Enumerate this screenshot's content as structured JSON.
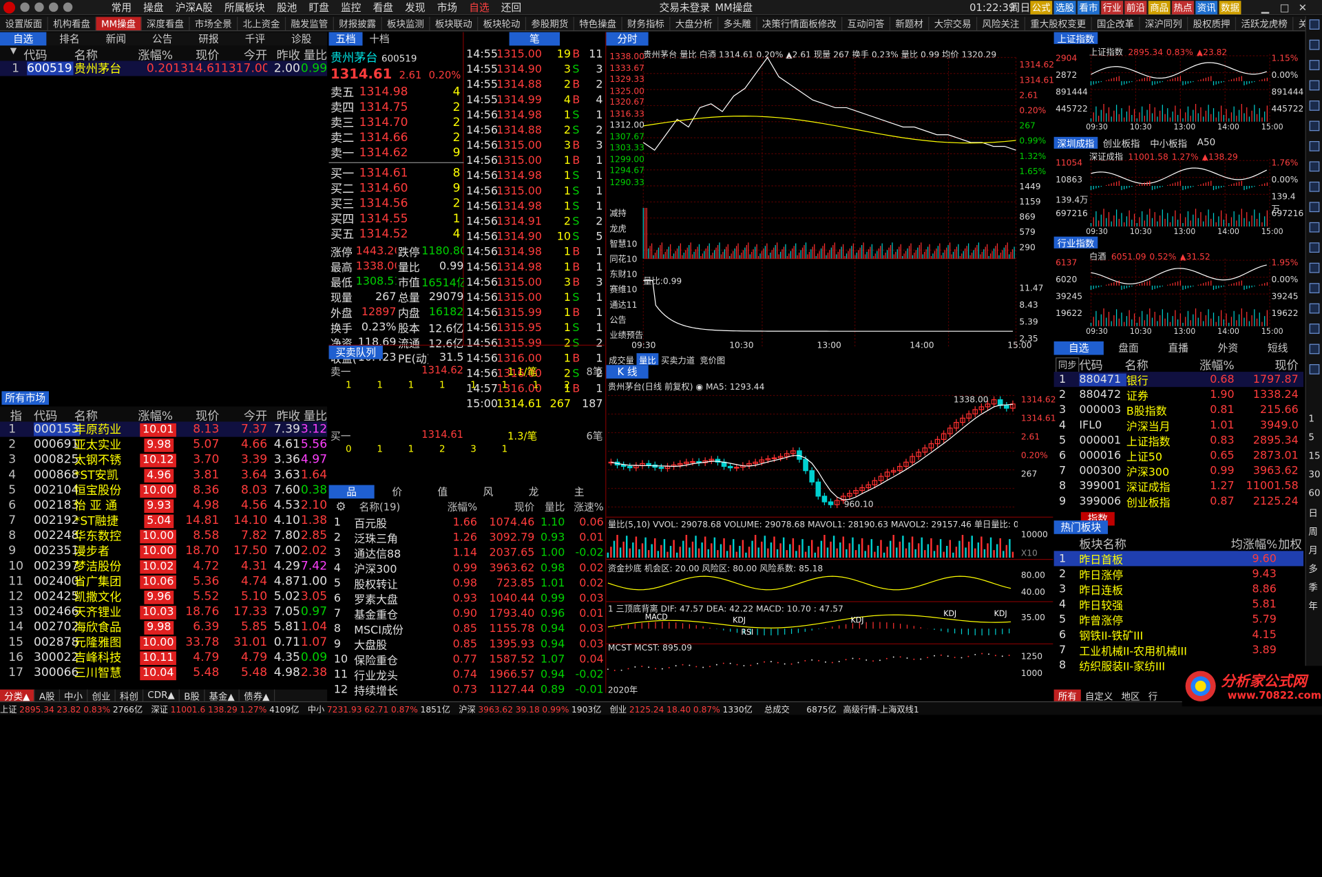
{
  "titlebar": {
    "menu": [
      "常用",
      "操盘",
      "沪深A股",
      "所属板块",
      "股池",
      "盯盘",
      "监控",
      "看盘",
      "发现",
      "市场",
      "自选",
      "还回"
    ],
    "center_tabs": [
      "交易未登录",
      "MM操盘"
    ],
    "clock": "01:22:39",
    "weekday": "周日",
    "right_buttons": [
      "公式",
      "选股",
      "看市",
      "行业",
      "前沿",
      "商品",
      "热点",
      "资讯",
      "数据"
    ]
  },
  "toolbar": {
    "items": [
      "设置版面",
      "机构看盘",
      "MM操盘",
      "深度看盘",
      "市场全景",
      "北上资金",
      "融发监管",
      "财报披露",
      "板块监测",
      "板块联动",
      "板块轮动",
      "参股期货",
      "特色操盘",
      "财务指标",
      "大盘分析",
      "多头雕",
      "决策行情面板修改",
      "互动问答",
      "新题材",
      "大宗交易",
      "风险关注",
      "重大股权变更",
      "国企改革",
      "深沪同列",
      "股权质押",
      "活跃龙虎榜",
      "关注"
    ]
  },
  "left_tabs": [
    "自选",
    "排名",
    "新闻",
    "公告",
    "研报",
    "千评",
    "诊股"
  ],
  "watch_headers": [
    "代码",
    "名称",
    "涨幅%",
    "现价",
    "今开",
    "昨收",
    "量比"
  ],
  "watch": [
    {
      "n": "1",
      "code": "600519",
      "name": "贵州茅台",
      "chg": "0.20",
      "price": "1314.61",
      "open": "1317.00",
      "prev": "2.00",
      "vr": "0.99"
    }
  ],
  "market_title": "所有市场",
  "market_headers": [
    "指",
    "代码",
    "名称",
    "涨幅%",
    "现价",
    "今开",
    "昨收",
    "量比"
  ],
  "market": [
    {
      "n": "1",
      "code": "000153",
      "name": "丰原药业",
      "chg": "10.01",
      "price": "8.13",
      "open": "7.37",
      "prev": "7.39",
      "vr": "3.12",
      "vc": "mag"
    },
    {
      "n": "2",
      "code": "000691",
      "name": "亚太实业",
      "chg": "9.98",
      "price": "5.07",
      "open": "4.66",
      "prev": "4.61",
      "vr": "5.56",
      "vc": "mag"
    },
    {
      "n": "3",
      "code": "000825",
      "name": "太钢不锈",
      "chg": "10.12",
      "price": "3.70",
      "open": "3.39",
      "prev": "3.36",
      "vr": "4.97",
      "vc": "mag"
    },
    {
      "n": "4",
      "code": "000868",
      "name": "*ST安凯",
      "chg": "4.96",
      "price": "3.81",
      "open": "3.64",
      "prev": "3.63",
      "vr": "1.64",
      "vc": "red"
    },
    {
      "n": "5",
      "code": "002104",
      "name": "恒宝股份",
      "chg": "10.00",
      "price": "8.36",
      "open": "8.03",
      "prev": "7.60",
      "vr": "0.38",
      "vc": "grn"
    },
    {
      "n": "6",
      "code": "002183",
      "name": "怡 亚 通",
      "chg": "9.93",
      "price": "4.98",
      "open": "4.56",
      "prev": "4.53",
      "vr": "2.10",
      "vc": "red"
    },
    {
      "n": "7",
      "code": "002192",
      "name": "*ST融捷",
      "chg": "5.04",
      "price": "14.81",
      "open": "14.10",
      "prev": "4.10",
      "vr": "1.38",
      "vc": "red"
    },
    {
      "n": "8",
      "code": "002248",
      "name": "华东数控",
      "chg": "10.00",
      "price": "8.58",
      "open": "7.82",
      "prev": "7.80",
      "vr": "2.85",
      "vc": "red"
    },
    {
      "n": "9",
      "code": "002351",
      "name": "漫步者",
      "chg": "10.00",
      "price": "18.70",
      "open": "17.50",
      "prev": "7.00",
      "vr": "2.02",
      "vc": "red"
    },
    {
      "n": "10",
      "code": "002397",
      "name": "梦洁股份",
      "chg": "10.02",
      "price": "4.72",
      "open": "4.31",
      "prev": "4.29",
      "vr": "7.42",
      "vc": "mag"
    },
    {
      "n": "11",
      "code": "002400",
      "name": "省广集团",
      "chg": "10.06",
      "price": "5.36",
      "open": "4.74",
      "prev": "4.87",
      "vr": "1.00",
      "vc": "wht"
    },
    {
      "n": "12",
      "code": "002425",
      "name": "凯撒文化",
      "chg": "9.96",
      "price": "5.52",
      "open": "5.10",
      "prev": "5.02",
      "vr": "3.05",
      "vc": "red"
    },
    {
      "n": "13",
      "code": "002466",
      "name": "天齐锂业",
      "chg": "10.03",
      "price": "18.76",
      "open": "17.33",
      "prev": "7.05",
      "vr": "0.97",
      "vc": "grn"
    },
    {
      "n": "14",
      "code": "002702",
      "name": "海欣食品",
      "chg": "9.98",
      "price": "6.39",
      "open": "5.85",
      "prev": "5.81",
      "vr": "1.04",
      "vc": "red"
    },
    {
      "n": "15",
      "code": "002878",
      "name": "元隆雅图",
      "chg": "10.00",
      "price": "33.78",
      "open": "31.01",
      "prev": "0.71",
      "vr": "1.07",
      "vc": "red"
    },
    {
      "n": "16",
      "code": "300022",
      "name": "吉峰科技",
      "chg": "10.11",
      "price": "4.79",
      "open": "4.79",
      "prev": "4.35",
      "vr": "0.09",
      "vc": "grn"
    },
    {
      "n": "17",
      "code": "300066",
      "name": "三川智慧",
      "chg": "10.04",
      "price": "5.48",
      "open": "5.48",
      "prev": "4.98",
      "vr": "2.38",
      "vc": "red"
    }
  ],
  "bottom_tabs": [
    "分类▲",
    "A股",
    "中小",
    "创业",
    "科创",
    "CDR▲",
    "B股",
    "基金▲",
    "债券▲"
  ],
  "quote": {
    "tabs": [
      "五档",
      "十档"
    ],
    "name": "贵州茅台",
    "code": "600519",
    "price": "1314.61",
    "change": "2.61",
    "pct": "0.20%",
    "asks": [
      {
        "l": "卖五",
        "p": "1314.98",
        "v": "4"
      },
      {
        "l": "卖四",
        "p": "1314.75",
        "v": "2"
      },
      {
        "l": "卖三",
        "p": "1314.70",
        "v": "2"
      },
      {
        "l": "卖二",
        "p": "1314.66",
        "v": "2"
      },
      {
        "l": "卖一",
        "p": "1314.62",
        "v": "9"
      }
    ],
    "bids": [
      {
        "l": "买一",
        "p": "1314.61",
        "v": "8"
      },
      {
        "l": "买二",
        "p": "1314.60",
        "v": "9"
      },
      {
        "l": "买三",
        "p": "1314.56",
        "v": "2"
      },
      {
        "l": "买四",
        "p": "1314.55",
        "v": "1"
      },
      {
        "l": "买五",
        "p": "1314.52",
        "v": "4"
      }
    ],
    "stats": [
      [
        "涨停",
        "1443.20",
        "跌停",
        "1180.80"
      ],
      [
        "最高",
        "1338.00",
        "量比",
        "0.99"
      ],
      [
        "最低",
        "1308.51",
        "市值",
        "16514亿"
      ],
      [
        "现量",
        "267",
        "总量",
        "29079"
      ],
      [
        "外盘",
        "12897",
        "内盘",
        "16182"
      ],
      [
        "换手",
        "0.23%",
        "股本",
        "12.6亿"
      ],
      [
        "净资",
        "118.69",
        "流通",
        "12.6亿"
      ],
      [
        "收益(一)",
        "10.423",
        "PE(动)",
        "31.5"
      ]
    ]
  },
  "ticks_title": "笔",
  "ticks": [
    [
      "14:55",
      "1315.00",
      "19",
      "B",
      "11"
    ],
    [
      "14:55",
      "1314.90",
      "3",
      "S",
      "3"
    ],
    [
      "14:55",
      "1314.88",
      "2",
      "B",
      "2"
    ],
    [
      "14:55",
      "1314.99",
      "4",
      "B",
      "4"
    ],
    [
      "14:56",
      "1314.98",
      "1",
      "S",
      "1"
    ],
    [
      "14:56",
      "1314.88",
      "2",
      "S",
      "2"
    ],
    [
      "14:56",
      "1315.00",
      "3",
      "B",
      "3"
    ],
    [
      "14:56",
      "1315.00",
      "1",
      "B",
      "1"
    ],
    [
      "14:56",
      "1314.98",
      "1",
      "S",
      "1"
    ],
    [
      "14:56",
      "1315.00",
      "1",
      "S",
      "1"
    ],
    [
      "14:56",
      "1314.98",
      "1",
      "S",
      "1"
    ],
    [
      "14:56",
      "1314.91",
      "2",
      "S",
      "2"
    ],
    [
      "14:56",
      "1314.90",
      "10",
      "S",
      "5"
    ],
    [
      "14:56",
      "1314.98",
      "1",
      "B",
      "1"
    ],
    [
      "14:56",
      "1314.98",
      "1",
      "B",
      "1"
    ],
    [
      "14:56",
      "1315.00",
      "3",
      "B",
      "3"
    ],
    [
      "14:56",
      "1315.00",
      "1",
      "S",
      "1"
    ],
    [
      "14:56",
      "1315.99",
      "1",
      "B",
      "1"
    ],
    [
      "14:56",
      "1315.95",
      "1",
      "S",
      "1"
    ],
    [
      "14:56",
      "1315.99",
      "2",
      "S",
      "2"
    ],
    [
      "14:56",
      "1316.00",
      "1",
      "B",
      "1"
    ],
    [
      "14:56",
      "1316.00",
      "2",
      "S",
      "2"
    ],
    [
      "14:57",
      "1316.00",
      "1",
      "B",
      "1"
    ],
    [
      "15:00",
      "1314.61",
      "267",
      "",
      "187"
    ]
  ],
  "queue": {
    "title": "买卖队列",
    "sell_label": "卖一",
    "sell_price": "1314.62",
    "sell_rate": "1.1/笔",
    "sell_count": "8笔",
    "sell_vols": [
      "1",
      "1",
      "1",
      "1",
      "1",
      "1",
      "1",
      "2"
    ],
    "buy_label": "买一",
    "buy_price": "1314.61",
    "buy_rate": "1.3/笔",
    "buy_count": "6笔",
    "buy_vols": [
      "0",
      "1",
      "1",
      "2",
      "3",
      "1"
    ]
  },
  "sector": {
    "tabs": [
      "品",
      "价",
      "值",
      "风",
      "龙",
      "主"
    ],
    "headers": [
      "名称(19)",
      "涨幅%",
      "现价",
      "量比",
      "涨速%"
    ],
    "rows": [
      [
        "1",
        "百元股",
        "1.66",
        "1074.46",
        "1.10",
        "0.06"
      ],
      [
        "2",
        "泛珠三角",
        "1.26",
        "3092.79",
        "0.93",
        "0.01"
      ],
      [
        "3",
        "通达信88",
        "1.14",
        "2037.65",
        "1.00",
        "-0.02"
      ],
      [
        "4",
        "沪深300",
        "0.99",
        "3963.62",
        "0.98",
        "0.02"
      ],
      [
        "5",
        "股权转让",
        "0.98",
        "723.85",
        "1.01",
        "0.02"
      ],
      [
        "6",
        "罗素大盘",
        "0.93",
        "1040.44",
        "0.99",
        "0.03"
      ],
      [
        "7",
        "基金重仓",
        "0.90",
        "1793.40",
        "0.96",
        "0.01"
      ],
      [
        "8",
        "MSCI成份",
        "0.85",
        "1155.78",
        "0.94",
        "0.03"
      ],
      [
        "9",
        "大盘股",
        "0.85",
        "1395.93",
        "0.94",
        "0.03"
      ],
      [
        "10",
        "保险重仓",
        "0.77",
        "1587.52",
        "1.07",
        "0.04"
      ],
      [
        "11",
        "行业龙头",
        "0.74",
        "1966.57",
        "0.94",
        "-0.02"
      ],
      [
        "12",
        "持续增长",
        "0.73",
        "1127.44",
        "0.89",
        "-0.01"
      ]
    ]
  },
  "intraday": {
    "tab": "分时",
    "header": "贵州茅台  量比 白酒 1314.61 0.20% ▲2.61 现量 267 换手 0.23% 量比 0.99 均价 1320.29",
    "left_axis": [
      "1338.00",
      "1333.67",
      "1329.33",
      "1325.00",
      "1320.67",
      "1316.33",
      "1312.00",
      "1307.67",
      "1303.33",
      "1299.00",
      "1294.67",
      "1290.33"
    ],
    "right_axis": [
      "1314.62",
      "1314.61",
      "2.61",
      "0.20%",
      "267",
      "0.99%",
      "1.32%",
      "1.65%",
      "1449",
      "1159",
      "869",
      "579",
      "290"
    ],
    "side_labels": [
      "减持",
      "龙虎",
      "智慧10",
      "同花10",
      "东财10",
      "赛维10",
      "通达11",
      "公告",
      "业绩预告"
    ],
    "vol_label": "量比:0.99",
    "vol_axis": [
      "11.47",
      "8.43",
      "5.39",
      "2.35"
    ],
    "times": [
      "09:30",
      "10:30",
      "13:00",
      "14:00",
      "15:00"
    ],
    "subtabs": [
      "成交量",
      "量比",
      "买卖力道",
      "竞价图"
    ],
    "price_series": [
      1316,
      1314,
      1318,
      1322,
      1320,
      1325,
      1326,
      1324,
      1328,
      1330,
      1334,
      1338,
      1333,
      1331,
      1329,
      1327,
      1326,
      1325,
      1325,
      1324,
      1323,
      1322,
      1321,
      1320,
      1320,
      1319,
      1318,
      1318,
      1317,
      1316,
      1316,
      1315,
      1315,
      1314
    ]
  },
  "kline": {
    "tab": "K 线",
    "header": "贵州茅台(日线 前复权) ◉ MA5: 1293.44",
    "high_label": "1338.00",
    "low_label": "960.10",
    "right_axis": [
      "1314.62",
      "1314.61",
      "2.61",
      "0.20%",
      "267"
    ],
    "closes": [
      1110,
      1100,
      1095,
      1090,
      1098,
      1105,
      1100,
      1092,
      1088,
      1095,
      1100,
      1105,
      1110,
      1112,
      1108,
      1115,
      1120,
      1110,
      1095,
      1090,
      1092,
      1098,
      1105,
      1110,
      1118,
      1122,
      1125,
      1130,
      1140,
      1150,
      1120,
      1080,
      1040,
      990,
      970,
      960,
      975,
      990,
      1000,
      1010,
      1020,
      1030,
      1045,
      1060,
      1075,
      1080,
      1095,
      1110,
      1130,
      1145,
      1160,
      1175,
      1190,
      1210,
      1230,
      1250,
      1265,
      1280,
      1295,
      1305,
      1315,
      1330,
      1310,
      1300,
      1315
    ],
    "vol_header": "量比(5,10) VVOL: 29078.68  VOLUME: 29078.68  MAVOL1: 28190.63  MAVOL2: 29157.46  单日量比: 0.99",
    "vol_axis": [
      "10000",
      "X10"
    ],
    "ind1_header": "资金抄底  机会区: 20.00  风险区: 80.00  风险系数: 85.18",
    "ind1_axis": [
      "80.00",
      "40.00"
    ],
    "ind2_header": "1 三顶底背离  DIF: 47.57  DEA: 42.22  MACD: 10.70  : 47.57",
    "ind2_axis": [
      "35.00"
    ],
    "ind2_labels": [
      "MACD",
      "KDJ",
      "KDJ",
      "KDJ",
      "KDJ",
      "RSI"
    ],
    "ind3_header": "MCST  MCST: 895.09",
    "ind3_axis": [
      "1250",
      "1000"
    ],
    "year": "2020年"
  },
  "indices": [
    {
      "title": "上证指数",
      "tabs": [],
      "name": "上证指数",
      "value": "2895.34",
      "pct": "0.83%",
      "chg": "▲23.82",
      "left": [
        "2904",
        "2872",
        "891444",
        "445722"
      ],
      "right": [
        "1.15%",
        "0.00%",
        "891444",
        "445722"
      ],
      "times": [
        "09:30",
        "10:30",
        "13:00",
        "14:00",
        "15:00"
      ]
    },
    {
      "title": "深圳成指",
      "tabs": [
        "创业板指",
        "中小板指",
        "A50"
      ],
      "name": "深证成指",
      "value": "11001.58",
      "pct": "1.27%",
      "chg": "▲138.29",
      "left": [
        "11054",
        "10863",
        "139.4万",
        "697216"
      ],
      "right": [
        "1.76%",
        "0.00%",
        "139.4万",
        "697216"
      ],
      "times": [
        "09:30",
        "10:30",
        "13:00",
        "14:00",
        "15:00"
      ]
    },
    {
      "title": "行业指数",
      "tabs": [],
      "name": "白酒",
      "value": "6051.09",
      "pct": "0.52%",
      "chg": "▲31.52",
      "left": [
        "6137",
        "6020",
        "39245",
        "19622"
      ],
      "right": [
        "1.95%",
        "0.00%",
        "39245",
        "19622"
      ],
      "times": [
        "09:30",
        "10:30",
        "13:00",
        "14:00",
        "15:00"
      ]
    }
  ],
  "right_list": {
    "tabs": [
      "自选",
      "盘面",
      "直播",
      "外资",
      "短线"
    ],
    "sync": "同步",
    "headers": [
      "代码",
      "名称",
      "涨幅%",
      "现价"
    ],
    "rows": [
      [
        "1",
        "880471",
        "银行",
        "0.68",
        "1797.87"
      ],
      [
        "2",
        "880472",
        "证券",
        "1.90",
        "1338.24"
      ],
      [
        "3",
        "000003",
        "B股指数",
        "0.81",
        "215.66"
      ],
      [
        "4",
        "IFL0",
        "沪深当月",
        "1.01",
        "3949.0"
      ],
      [
        "5",
        "000001",
        "上证指数",
        "0.83",
        "2895.34"
      ],
      [
        "6",
        "000016",
        "上证50",
        "0.65",
        "2873.01"
      ],
      [
        "7",
        "000300",
        "沪深300",
        "0.99",
        "3963.62"
      ],
      [
        "8",
        "399001",
        "深证成指",
        "1.27",
        "11001.58"
      ],
      [
        "9",
        "399006",
        "创业板指",
        "0.87",
        "2125.24"
      ]
    ],
    "bottom_tab": "指数"
  },
  "hot": {
    "title": "热门板块",
    "headers": [
      "板块名称",
      "均涨幅%",
      "加权"
    ],
    "rows": [
      [
        "1",
        "昨日首板",
        "9.60"
      ],
      [
        "2",
        "昨日涨停",
        "9.43"
      ],
      [
        "3",
        "昨日连板",
        "8.86"
      ],
      [
        "4",
        "昨日较强",
        "5.81"
      ],
      [
        "5",
        "昨曾涨停",
        "5.79"
      ],
      [
        "6",
        "钢铁II-铁矿III",
        "4.15"
      ],
      [
        "7",
        "工业机械II-农用机械III",
        "3.89"
      ],
      [
        "8",
        "纺织服装II-家纺III",
        ""
      ]
    ],
    "tabs": [
      "所有",
      "自定义",
      "地区",
      "行"
    ]
  },
  "status": {
    "items": [
      [
        "上证",
        "2895.34",
        "23.82",
        "0.83%",
        "2766亿"
      ],
      [
        "深证",
        "11001.6",
        "138.29",
        "1.27%",
        "4109亿"
      ],
      [
        "中小",
        "7231.93",
        "62.71",
        "0.87%",
        "1851亿"
      ],
      [
        "沪深",
        "3963.62",
        "39.18",
        "0.99%",
        "1903亿"
      ],
      [
        "创业",
        "2125.24",
        "18.40",
        "0.87%",
        "1330亿"
      ]
    ],
    "total": "总成交",
    "total_v": "6875亿",
    "feed": "高级行情-上海双线1"
  },
  "sidebar_right": [
    "1",
    "5",
    "15",
    "30",
    "60",
    "日",
    "周",
    "月",
    "多",
    "季",
    "年"
  ],
  "watermark": {
    "brand": "分析家公式网",
    "url": "www.70822.com"
  },
  "colors": {
    "bg": "#000000",
    "up": "#ff3c3c",
    "down": "#00d000",
    "accent": "#1f5fd0",
    "grid": "#7a0000"
  }
}
